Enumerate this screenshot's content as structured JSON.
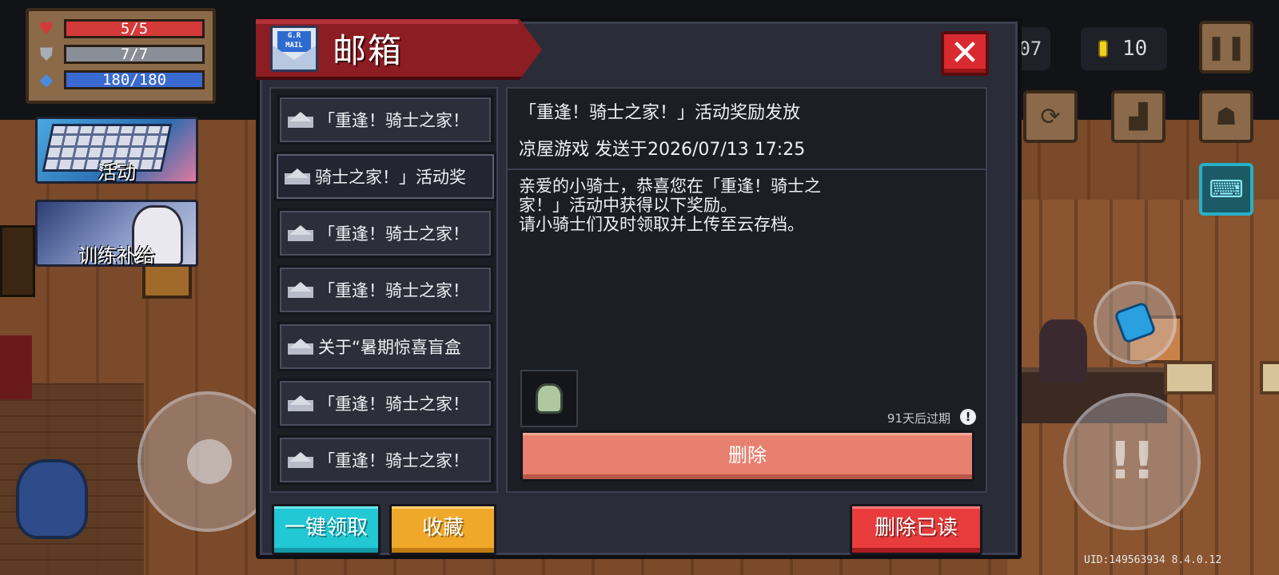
{
  "hud": {
    "hp": {
      "text": "5/5",
      "fill_ratio": 1.0,
      "color": "#d43a3a"
    },
    "armor": {
      "text": "7/7",
      "fill_ratio": 1.0,
      "color": "#8a8e96"
    },
    "energy": {
      "text": "180/180",
      "fill_ratio": 1.0,
      "color": "#3a6ad0"
    },
    "timer_fragment": ":07",
    "coins": "10",
    "event_label": "活动",
    "supply_label": "训练补给",
    "uid": "UID:149563934 8.4.0.12"
  },
  "dialog": {
    "title": "邮箱",
    "mail_icon_text": "G.R\nMAIL",
    "close_symbol": "✕",
    "mail_list": [
      {
        "title": "「重逢！骑士之家！"
      },
      {
        "title": "骑士之家！」活动奖"
      },
      {
        "title": "「重逢！骑士之家！"
      },
      {
        "title": "「重逢！骑士之家！"
      },
      {
        "title": "关于“暑期惊喜盲盒"
      },
      {
        "title": "「重逢！骑士之家！"
      },
      {
        "title": "「重逢！骑士之家！"
      }
    ],
    "selected_index": 1,
    "detail": {
      "title": "「重逢！骑士之家！」活动奖励发放",
      "meta": "凉屋游戏 发送于2026/07/13 17:25",
      "body": "亲爱的小骑士，恭喜您在「重逢！骑士之\n家！」活动中获得以下奖励。\n请小骑士们及时领取并上传至云存档。",
      "expire": "91天后过期",
      "expire_icon": "!",
      "delete_label": "删除"
    },
    "buttons": {
      "claim_all": "一键领取",
      "favorite": "收藏",
      "delete_read": "删除已读"
    }
  }
}
